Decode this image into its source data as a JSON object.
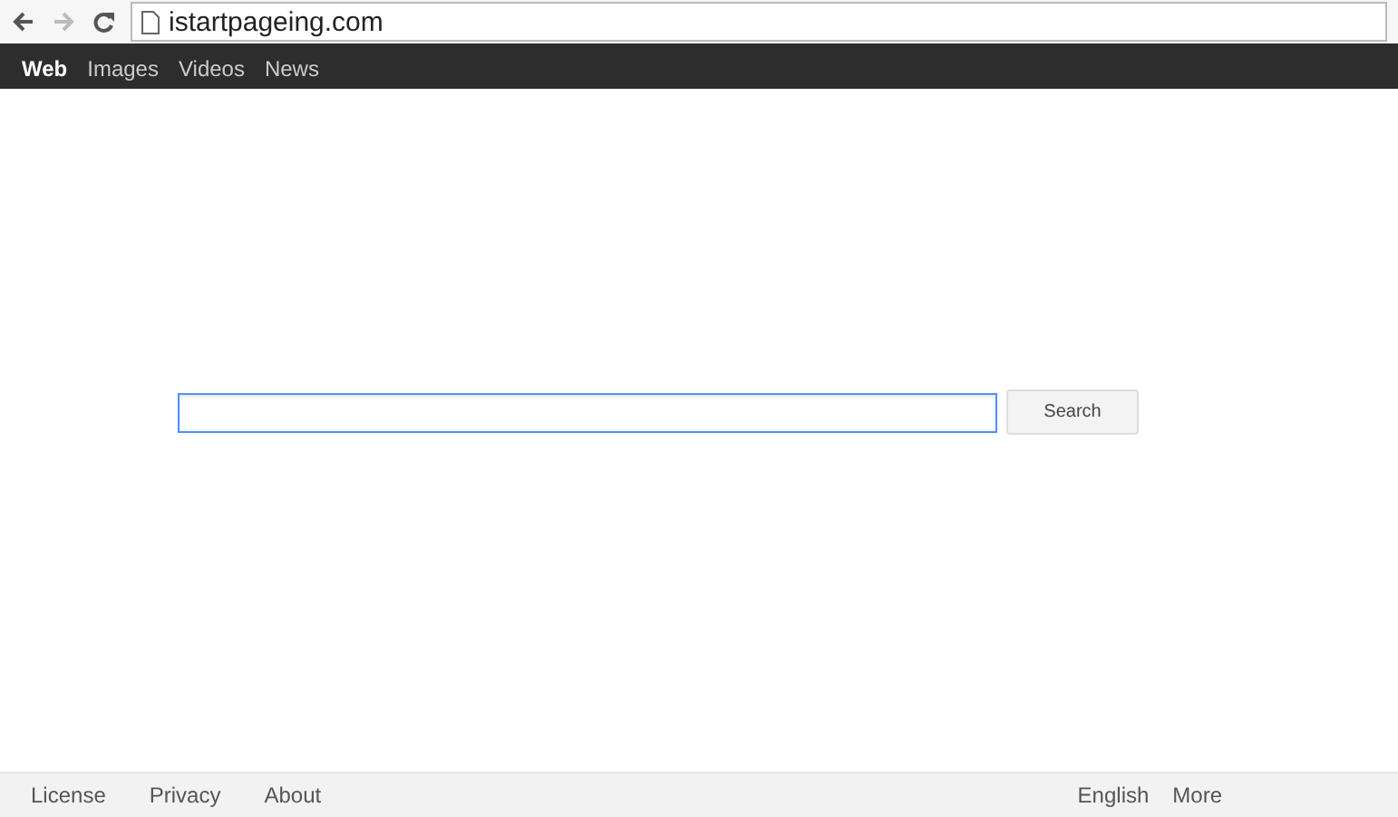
{
  "browser": {
    "url": "istartpageing.com"
  },
  "nav": [
    {
      "label": "Web",
      "selected": true
    },
    {
      "label": "Images",
      "selected": false
    },
    {
      "label": "Videos",
      "selected": false
    },
    {
      "label": "News",
      "selected": false
    }
  ],
  "search": {
    "button": "Search"
  },
  "footer": {
    "left": [
      "License",
      "Privacy",
      "About"
    ],
    "right": [
      "English",
      "More"
    ]
  }
}
